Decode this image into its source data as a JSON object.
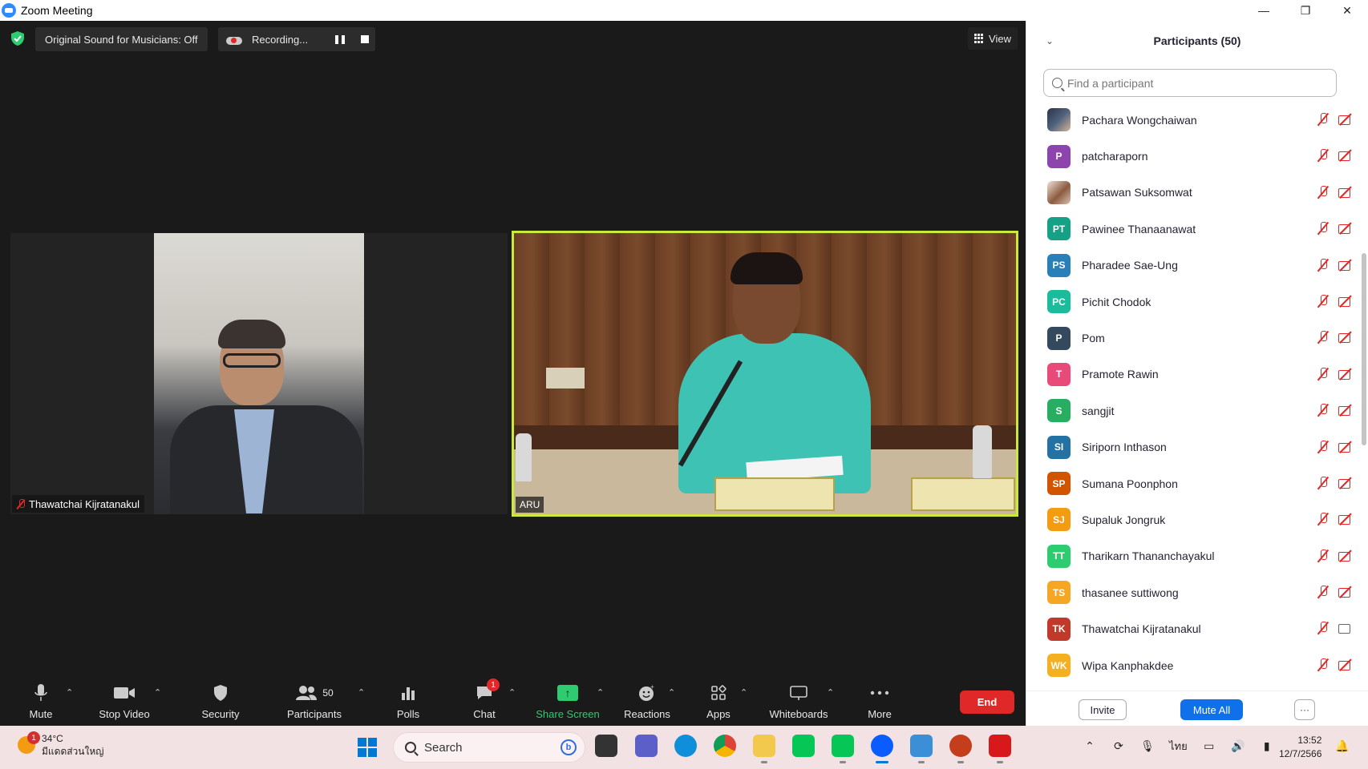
{
  "window": {
    "title": "Zoom Meeting",
    "controls": {
      "minimize": "—",
      "restore": "❐",
      "close": "✕"
    }
  },
  "meeting": {
    "original_sound": "Original Sound for Musicians: Off",
    "recording": "Recording...",
    "view_label": "View",
    "tiles": [
      {
        "name": "Thawatchai Kijratanakul",
        "muted": true
      },
      {
        "name": "ARU",
        "active_speaker": true
      }
    ]
  },
  "toolbar": {
    "mute": "Mute",
    "stop_video": "Stop Video",
    "security": "Security",
    "participants": "Participants",
    "participants_count": "50",
    "polls": "Polls",
    "chat": "Chat",
    "chat_badge": "1",
    "share_screen": "Share Screen",
    "reactions": "Reactions",
    "apps": "Apps",
    "whiteboards": "Whiteboards",
    "more": "More",
    "end": "End",
    "share_color": "#2ecc71",
    "end_color": "#e02828"
  },
  "panel": {
    "title": "Participants (50)",
    "search_placeholder": "Find a participant",
    "participants": [
      {
        "initials": "",
        "name": "Pachara Wongchaiwan",
        "avatar": "photo1",
        "color": ""
      },
      {
        "initials": "P",
        "name": "patcharaporn",
        "color": "#8e44ad"
      },
      {
        "initials": "",
        "name": "Patsawan Suksomwat",
        "avatar": "photo2",
        "color": ""
      },
      {
        "initials": "PT",
        "name": "Pawinee Thanaanawat",
        "color": "#16a085"
      },
      {
        "initials": "PS",
        "name": "Pharadee Sae-Ung",
        "color": "#2980b9"
      },
      {
        "initials": "PC",
        "name": "Pichit Chodok",
        "color": "#1abc9c"
      },
      {
        "initials": "P",
        "name": "Pom",
        "color": "#34495e"
      },
      {
        "initials": "T",
        "name": "Pramote Rawin",
        "color": "#e84a7a"
      },
      {
        "initials": "S",
        "name": "sangjit",
        "color": "#27ae60"
      },
      {
        "initials": "SI",
        "name": "Siriporn Inthason",
        "color": "#2471a3"
      },
      {
        "initials": "SP",
        "name": "Sumana Poonphon",
        "color": "#d35400"
      },
      {
        "initials": "SJ",
        "name": "Supaluk Jongruk",
        "color": "#f39c12"
      },
      {
        "initials": "TT",
        "name": "Tharikarn Thananchayakul",
        "color": "#2ecc71"
      },
      {
        "initials": "TS",
        "name": "thasanee suttiwong",
        "color": "#f5a623"
      },
      {
        "initials": "TK",
        "name": "Thawatchai Kijratanakul",
        "color": "#c0392b",
        "video_on": true
      },
      {
        "initials": "WK",
        "name": "Wipa  Kanphakdee",
        "color": "#f5b022"
      }
    ],
    "invite": "Invite",
    "mute_all": "Mute All",
    "more": "···"
  },
  "taskbar": {
    "weather_badge": "1",
    "temperature": "34°C",
    "weather_desc": "มีแดดส่วนใหญ่",
    "search": "Search",
    "language": "ไทย",
    "time": "13:52",
    "date": "12/7/2566"
  }
}
